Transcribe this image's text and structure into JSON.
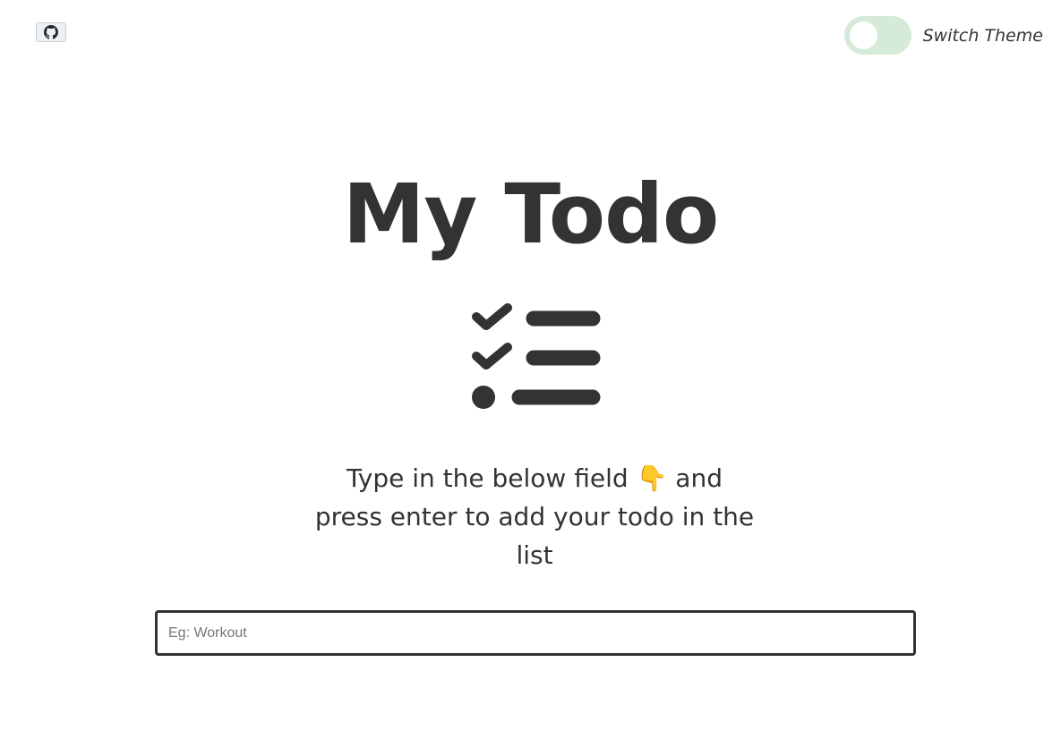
{
  "header": {
    "github_icon": "github-icon",
    "theme_toggle": {
      "label": "Switch Theme",
      "state": "off",
      "track_color": "#d6ead9"
    }
  },
  "main": {
    "title": "My Todo",
    "hero_icon": "checklist-icon",
    "instructions": {
      "line1": "Type in the below field 👇 and",
      "line2": "press enter to add your todo in the",
      "line3": "list"
    },
    "todo_input": {
      "value": "",
      "placeholder": "Eg: Workout"
    }
  },
  "colors": {
    "text": "#333333",
    "background": "#ffffff"
  }
}
